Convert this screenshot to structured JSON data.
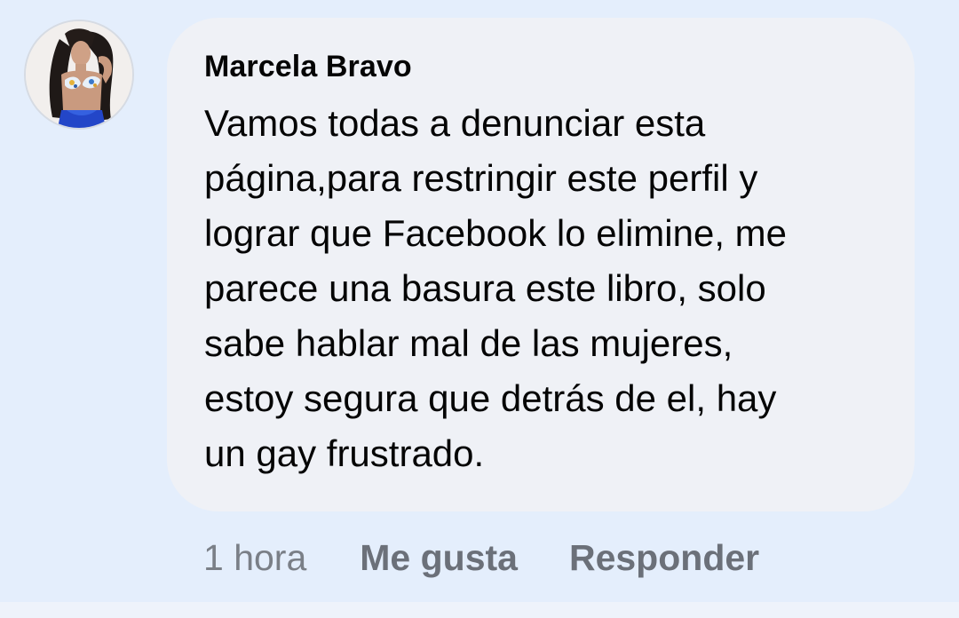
{
  "comment": {
    "author": "Marcela Bravo",
    "text": "Vamos todas a denunciar esta\npágina,para restringir este perfil y\nlograr que Facebook lo elimine, me\nparece una basura este libro, solo\nsabe hablar mal de las mujeres,\nestoy segura que detrás de el, hay\nun gay frustrado.",
    "timestamp": "1 hora",
    "like_label": "Me gusta",
    "reply_label": "Responder"
  },
  "colors": {
    "background": "#e4eefc",
    "bubble": "#eff1f6",
    "text": "#050505",
    "muted": "#6b7079"
  }
}
